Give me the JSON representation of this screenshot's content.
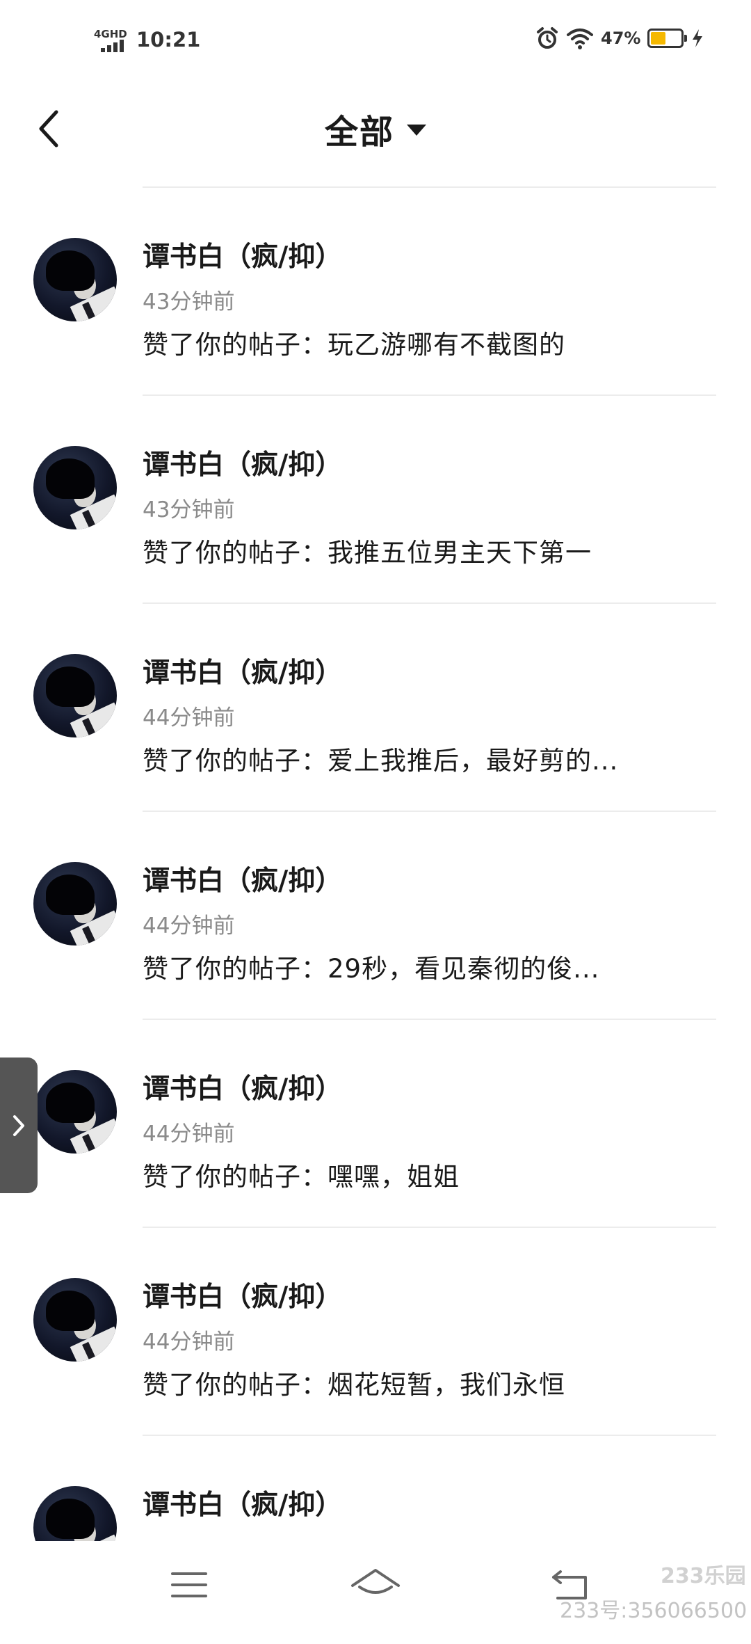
{
  "status_bar": {
    "network": "4GHD",
    "time": "10:21",
    "battery_percent": "47%",
    "battery_level": 0.47,
    "battery_color": "#f5b800"
  },
  "header": {
    "title": "全部",
    "back_icon": "chevron-left-icon",
    "dropdown_icon": "caret-down-icon"
  },
  "notifications": [
    {
      "name": "谭书白（疯/抑）",
      "time": "43分钟前",
      "text": "赞了你的帖子：玩乙游哪有不截图的"
    },
    {
      "name": "谭书白（疯/抑）",
      "time": "43分钟前",
      "text": "赞了你的帖子：我推五位男主天下第一"
    },
    {
      "name": "谭书白（疯/抑）",
      "time": "44分钟前",
      "text": "赞了你的帖子：爱上我推后，最好剪的..."
    },
    {
      "name": "谭书白（疯/抑）",
      "time": "44分钟前",
      "text": "赞了你的帖子：29秒，看见秦彻的俊..."
    },
    {
      "name": "谭书白（疯/抑）",
      "time": "44分钟前",
      "text": "赞了你的帖子：嘿嘿，姐姐"
    },
    {
      "name": "谭书白（疯/抑）",
      "time": "44分钟前",
      "text": "赞了你的帖子：烟花短暂，我们永恒"
    },
    {
      "name": "谭书白（疯/抑）",
      "time": "",
      "text": ""
    }
  ],
  "side_tab": {
    "icon": "chevron-right-icon"
  },
  "nav_bar": {
    "menu_icon": "menu-icon",
    "home_icon": "home-icon",
    "back_icon": "back-icon"
  },
  "watermark": {
    "logo": "233乐园",
    "id": "233号:356066500"
  }
}
